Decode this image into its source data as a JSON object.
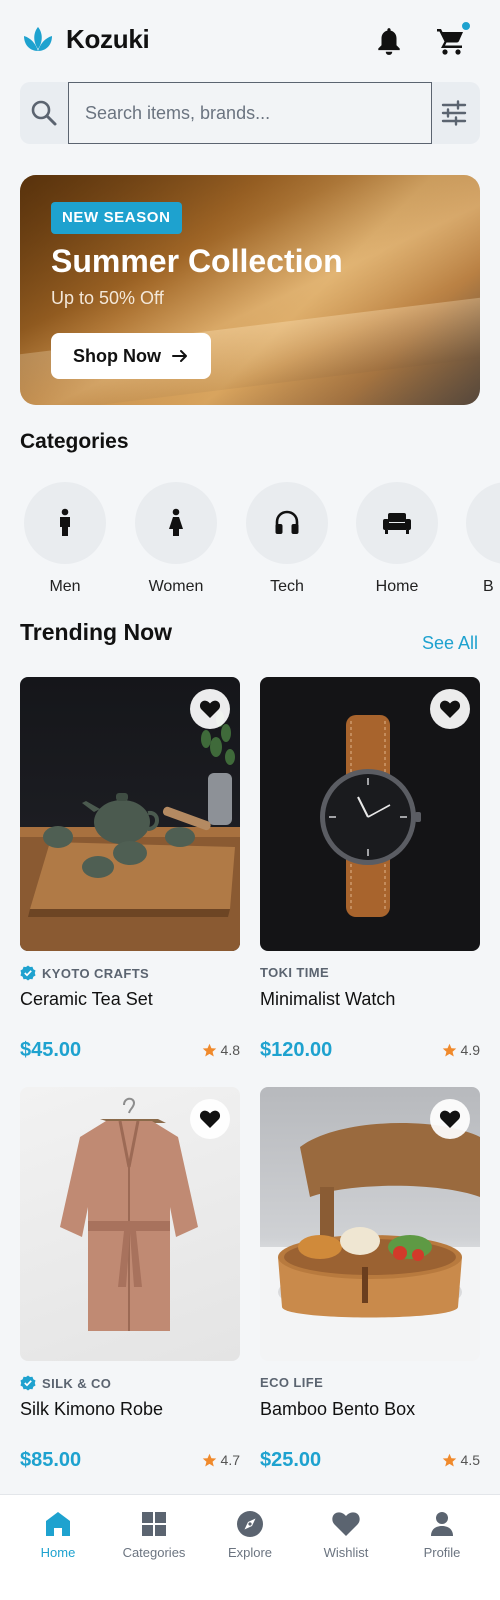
{
  "app": {
    "title": "Kozuki"
  },
  "colors": {
    "accent": "#1ea2cf",
    "rating": "#f08a2c"
  },
  "search": {
    "placeholder": "Search items, brands..."
  },
  "banner": {
    "badge": "NEW SEASON",
    "title": "Summer Collection",
    "subtitle": "Up to 50% Off",
    "button": "Shop Now"
  },
  "categories": {
    "title": "Categories",
    "items": [
      {
        "label": "Men",
        "icon": "man-icon"
      },
      {
        "label": "Women",
        "icon": "woman-icon"
      },
      {
        "label": "Tech",
        "icon": "headphones-icon"
      },
      {
        "label": "Home",
        "icon": "sofa-icon"
      },
      {
        "label": "B",
        "icon": "category-icon"
      }
    ]
  },
  "trending": {
    "title": "Trending Now",
    "see_all": "See All",
    "products": [
      {
        "brand": "KYOTO CRAFTS",
        "verified": true,
        "name": "Ceramic Tea Set",
        "price": "$45.00",
        "rating": "4.8"
      },
      {
        "brand": "TOKI TIME",
        "verified": false,
        "name": "Minimalist Watch",
        "price": "$120.00",
        "rating": "4.9"
      },
      {
        "brand": "SILK & CO",
        "verified": true,
        "name": "Silk Kimono Robe",
        "price": "$85.00",
        "rating": "4.7"
      },
      {
        "brand": "ECO LIFE",
        "verified": false,
        "name": "Bamboo Bento Box",
        "price": "$25.00",
        "rating": "4.5"
      }
    ]
  },
  "nav": {
    "items": [
      {
        "label": "Home",
        "icon": "home-icon",
        "active": true
      },
      {
        "label": "Categories",
        "icon": "grid-icon",
        "active": false
      },
      {
        "label": "Explore",
        "icon": "compass-icon",
        "active": false
      },
      {
        "label": "Wishlist",
        "icon": "heart-icon",
        "active": false
      },
      {
        "label": "Profile",
        "icon": "person-icon",
        "active": false
      }
    ]
  }
}
